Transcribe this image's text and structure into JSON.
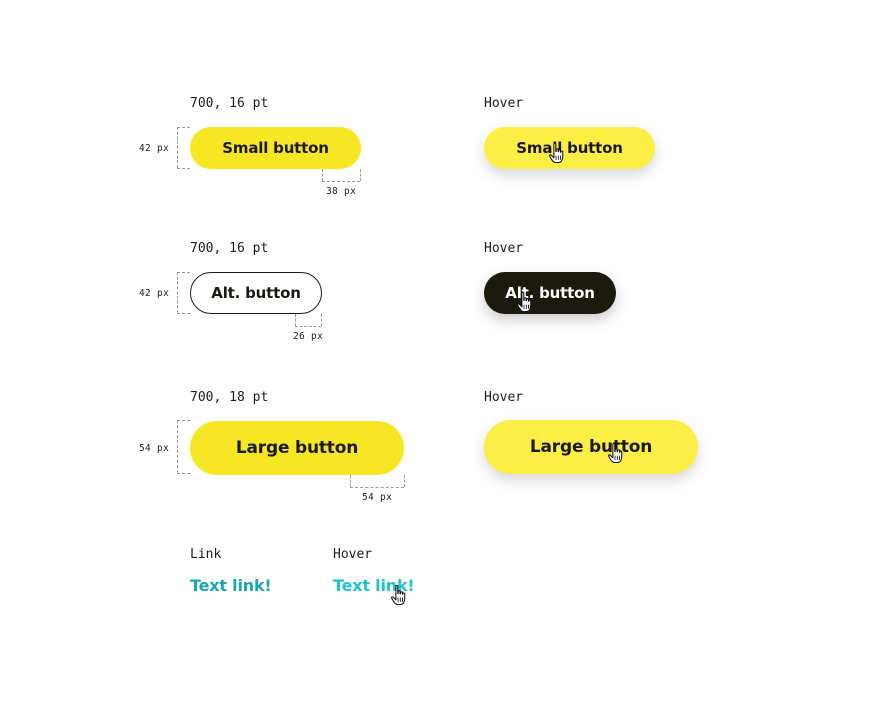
{
  "small": {
    "spec": "700, 16 pt",
    "hover_caption": "Hover",
    "label": "Small button",
    "height_dim": "42 px",
    "padding_dim": "38 px"
  },
  "alt": {
    "spec": "700, 16 pt",
    "hover_caption": "Hover",
    "label": "Alt. button",
    "height_dim": "42 px",
    "padding_dim": "26 px"
  },
  "large": {
    "spec": "700, 18 pt",
    "hover_caption": "Hover",
    "label": "Large button",
    "height_dim": "54 px",
    "padding_dim": "54 px"
  },
  "link": {
    "caption": "Link",
    "hover_caption": "Hover",
    "label": "Text link!"
  },
  "colors": {
    "primary": "#f7e623",
    "primary_hover": "#fcee44",
    "alt_hover": "#1c1a0c",
    "link": "#19a7b3",
    "link_hover": "#1fc4cf"
  },
  "icons": [
    "pointer-hand-cursor-icon"
  ]
}
